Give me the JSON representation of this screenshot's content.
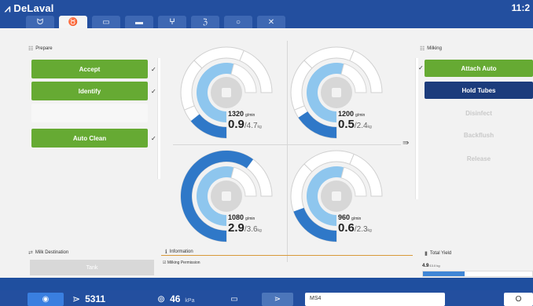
{
  "header": {
    "brand": "DeLaval",
    "clock": "11:2",
    "tabs": [
      {
        "id": "tab-1",
        "icon": "cow-icon"
      },
      {
        "id": "tab-2",
        "icon": "udder-icon"
      },
      {
        "id": "tab-3",
        "icon": "box-icon"
      },
      {
        "id": "tab-4",
        "icon": "feeder-icon"
      },
      {
        "id": "tab-5",
        "icon": "pulse-icon"
      },
      {
        "id": "tab-6",
        "icon": "flow-icon"
      },
      {
        "id": "tab-7",
        "icon": "circle-icon"
      },
      {
        "id": "tab-8",
        "icon": "wrench-icon"
      }
    ]
  },
  "prepare": {
    "title": "Prepare",
    "buttons": [
      "Accept",
      "Identify",
      "",
      "Auto Clean"
    ]
  },
  "milking": {
    "title": "Milking",
    "buttons": [
      "Attach Auto",
      "Hold Tubes",
      "Disinfect",
      "Backflush",
      "Release"
    ]
  },
  "quarters": [
    {
      "grams": "1320",
      "grams_unit": "g/min",
      "yield": "0.9",
      "expected": "/4.7",
      "unit": "kg",
      "fill": 0.19
    },
    {
      "grams": "1200",
      "grams_unit": "g/min",
      "yield": "0.5",
      "expected": "/2.4",
      "unit": "kg",
      "fill": 0.21
    },
    {
      "grams": "1080",
      "grams_unit": "g/min",
      "yield": "2.9",
      "expected": "/3.6",
      "unit": "kg",
      "fill": 0.8
    },
    {
      "grams": "960",
      "grams_unit": "g/min",
      "yield": "0.6",
      "expected": "/2.3",
      "unit": "kg",
      "fill": 0.26
    }
  ],
  "milk_destination": {
    "title": "Milk Destination",
    "button": "Tank"
  },
  "information": {
    "title": "Information",
    "text": "Milking Permission"
  },
  "total_yield": {
    "title": "Total Yield",
    "value": "4.9",
    "expected": "/13.0 kg",
    "fill": 0.38
  },
  "footer": {
    "cow_id": "5311",
    "stall": "46",
    "stall_unit": "kPa",
    "input_value": "MS4",
    "right_label": "O"
  },
  "colors": {
    "green": "#66aa33",
    "navy": "#1c3c7c",
    "blue_dark": "#2f78c8",
    "blue_light": "#8ec6ee",
    "header_blue": "#234f9f"
  }
}
